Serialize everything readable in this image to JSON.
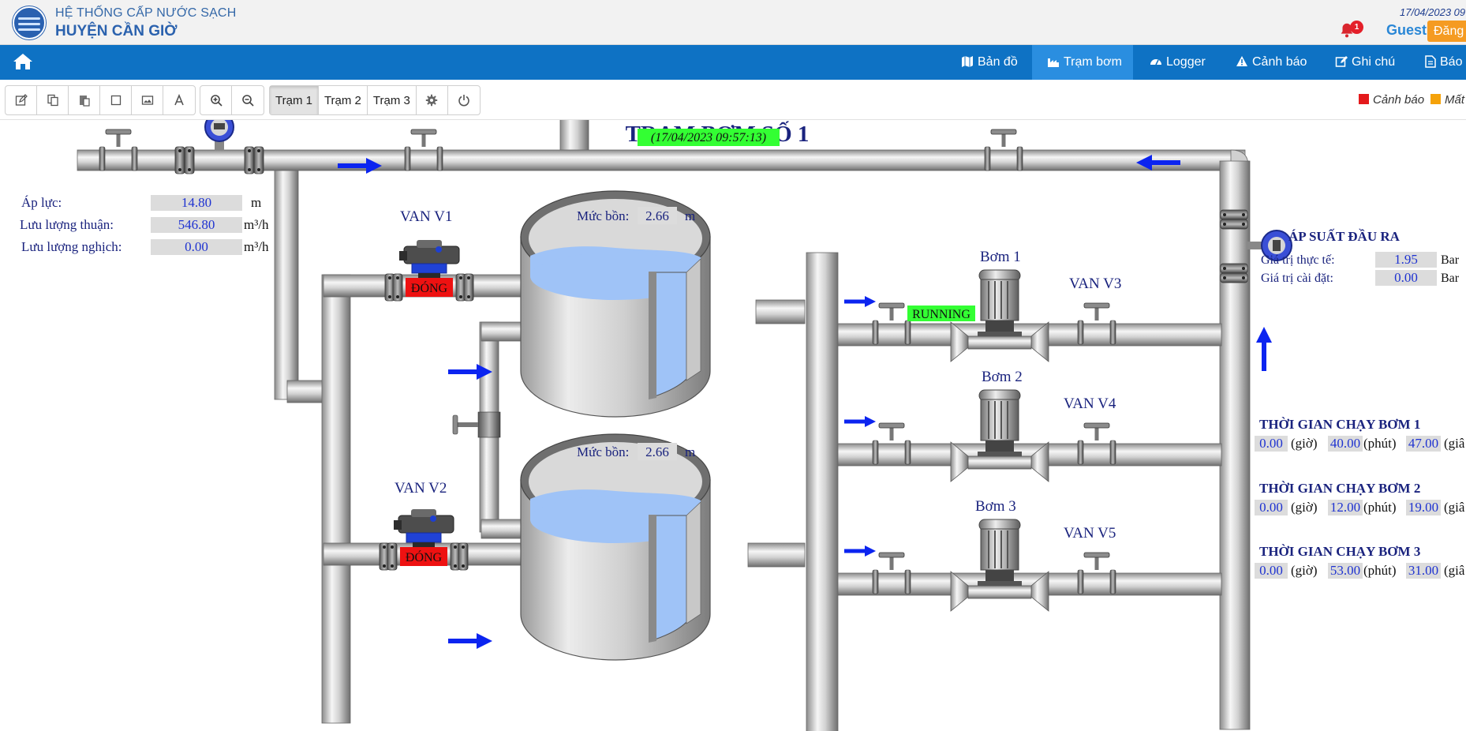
{
  "header": {
    "brand_line1": "HỆ THỐNG CẤP NƯỚC SẠCH",
    "brand_line2": "HUYỆN CẦN GIỜ",
    "datetime": "17/04/2023 09",
    "notification_count": "1",
    "user": "Guest",
    "login_label": "Đăng"
  },
  "nav": {
    "items": [
      {
        "label": "Bản đồ",
        "icon": "map-icon"
      },
      {
        "label": "Trạm bơm",
        "icon": "factory-icon",
        "active": true
      },
      {
        "label": "Logger",
        "icon": "gauge-icon"
      },
      {
        "label": "Cảnh báo",
        "icon": "warning-icon"
      },
      {
        "label": "Ghi chú",
        "icon": "note-icon"
      },
      {
        "label": "Báo c",
        "icon": "report-icon"
      }
    ]
  },
  "toolbar": {
    "tools": [
      "edit-icon",
      "copy-icon",
      "paste-icon",
      "rectangle-icon",
      "image-icon",
      "text-icon"
    ],
    "zoom": [
      "zoom-in-icon",
      "zoom-out-icon"
    ],
    "stations": [
      "Trạm 1",
      "Trạm 2",
      "Trạm 3"
    ],
    "active_station": "Trạm 1",
    "extra": [
      "gear-icon",
      "power-icon"
    ]
  },
  "legend": [
    {
      "label": "Cảnh báo",
      "color": "#e41a1c"
    },
    {
      "label": "Mất",
      "color": "#f5a20a"
    }
  ],
  "scada": {
    "title": "TRẠM BƠM SỐ 1",
    "timestamp": "(17/04/2023 09:57:13)",
    "inlet": {
      "pressure_label": "Áp lực:",
      "pressure_value": "14.80",
      "pressure_unit": "m",
      "forward_label": "Lưu lượng thuận:",
      "forward_value": "546.80",
      "forward_unit": "m³/h",
      "reverse_label": "Lưu lượng nghịch:",
      "reverse_value": "0.00",
      "reverse_unit": "m³/h"
    },
    "valves": [
      {
        "label": "VAN V1",
        "state": "ĐÓNG"
      },
      {
        "label": "VAN V2",
        "state": "ĐÓNG"
      },
      {
        "label": "VAN V3"
      },
      {
        "label": "VAN V4"
      },
      {
        "label": "VAN V5"
      }
    ],
    "tanks": [
      {
        "level_label": "Mức bồn:",
        "level_value": "2.66",
        "level_unit": "m"
      },
      {
        "level_label": "Mức bồn:",
        "level_value": "2.66",
        "level_unit": "m"
      }
    ],
    "pumps": [
      {
        "label": "Bơm 1",
        "status": "RUNNING"
      },
      {
        "label": "Bơm 2"
      },
      {
        "label": "Bơm 3"
      }
    ],
    "outlet": {
      "title": "ÁP SUẤT ĐẦU RA",
      "actual_label": "Giá trị thực tế:",
      "actual_value": "1.95",
      "actual_unit": "Bar",
      "setpoint_label": "Giá trị cài đặt:",
      "setpoint_value": "0.00",
      "setpoint_unit": "Bar"
    },
    "runtimes": [
      {
        "title": "THỜI GIAN CHẠY BƠM 1",
        "hours": "0.00",
        "minutes": "40.00",
        "seconds": "47.00"
      },
      {
        "title": "THỜI GIAN CHẠY BƠM 2",
        "hours": "0.00",
        "minutes": "12.00",
        "seconds": "19.00"
      },
      {
        "title": "THỜI GIAN CHẠY BƠM 3",
        "hours": "0.00",
        "minutes": "53.00",
        "seconds": "31.00"
      }
    ],
    "runtime_units": {
      "hours": "(giờ)",
      "minutes": "(phút)",
      "seconds": "(giâ"
    }
  }
}
